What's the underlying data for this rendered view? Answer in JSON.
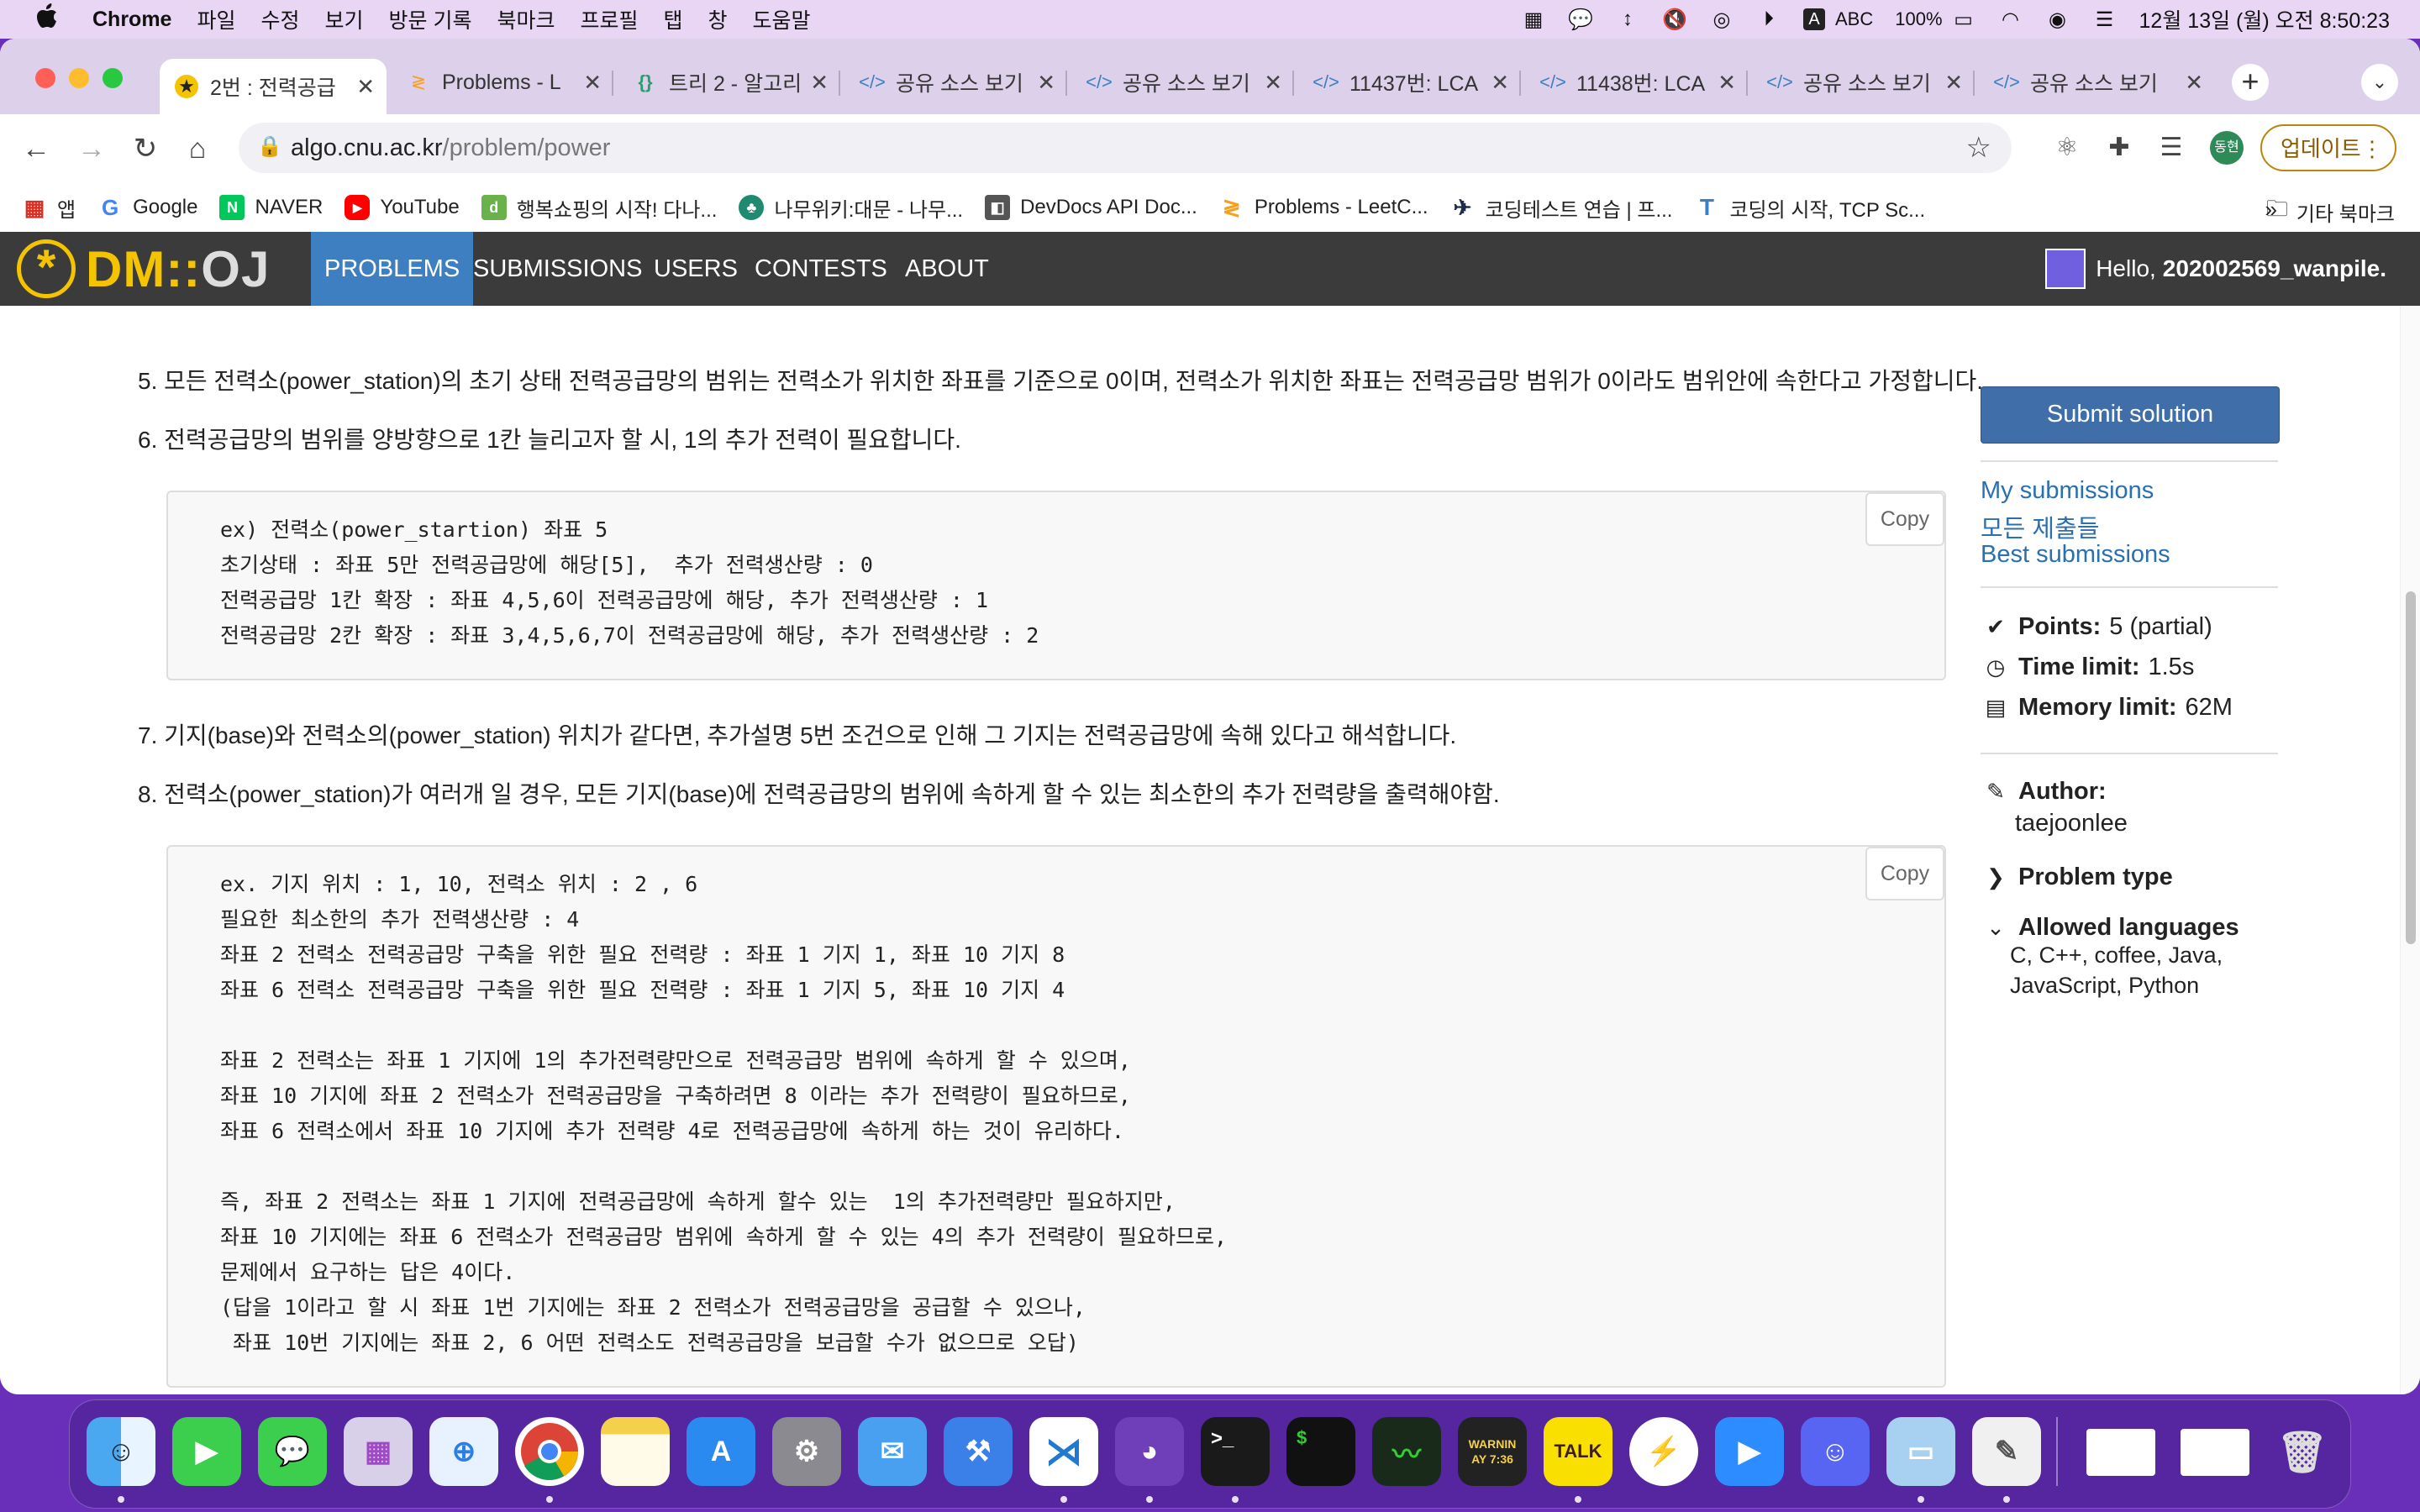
{
  "menubar": {
    "apple": "",
    "app": "Chrome",
    "items": [
      "파일",
      "수정",
      "보기",
      "방문 기록",
      "북마크",
      "프로필",
      "탭",
      "창",
      "도움말"
    ],
    "input_source": "ABC",
    "battery": "100%",
    "datetime": "12월 13일 (월) 오전 8:50:23"
  },
  "tabs": [
    {
      "title": "2번 : 전력공급",
      "icon": "dmoj-icon"
    },
    {
      "title": "Problems - L",
      "icon": "leetcode-icon"
    },
    {
      "title": "트리 2 - 알고리",
      "icon": "code-braces-icon"
    },
    {
      "title": "공유 소스 보기",
      "icon": "code-icon"
    },
    {
      "title": "공유 소스 보기",
      "icon": "code-icon"
    },
    {
      "title": "11437번: LCA",
      "icon": "code-icon"
    },
    {
      "title": "11438번: LCA",
      "icon": "code-icon"
    },
    {
      "title": "공유 소스 보기",
      "icon": "code-icon"
    },
    {
      "title": "공유 소스 보기",
      "icon": "code-icon"
    }
  ],
  "address": {
    "host": "algo.cnu.ac.kr",
    "path": "/problem/power"
  },
  "profile_badge": "동현",
  "update_label": "업데이트",
  "bookmarks": [
    {
      "label": "앱",
      "color": "#d93025",
      "glyph": "▦"
    },
    {
      "label": "Google",
      "color": "#4285f4",
      "glyph": "G"
    },
    {
      "label": "NAVER",
      "color": "#03c75a",
      "glyph": "N"
    },
    {
      "label": "YouTube",
      "color": "#ff0000",
      "glyph": "▶"
    },
    {
      "label": "행복쇼핑의 시작! 다나...",
      "color": "#6ab04c",
      "glyph": "d"
    },
    {
      "label": "나무위키:대문 - 나무...",
      "color": "#1f8a70",
      "glyph": "♣"
    },
    {
      "label": "DevDocs API Doc...",
      "color": "#555555",
      "glyph": "◧"
    },
    {
      "label": "Problems - LeetC...",
      "color": "#f89f1b",
      "glyph": "≷"
    },
    {
      "label": "코딩테스트 연습 | 프...",
      "color": "#1a2b4c",
      "glyph": "✈"
    },
    {
      "label": "코딩의 시작, TCP Sc...",
      "color": "#3d7fc1",
      "glyph": "T"
    }
  ],
  "bookmarks_more": "»",
  "bookmarks_other": "기타 북마크",
  "site": {
    "logo_main": "DM",
    "logo_sep": "::",
    "logo_oj": "OJ",
    "nav": [
      "PROBLEMS",
      "SUBMISSIONS",
      "USERS",
      "CONTESTS",
      "ABOUT"
    ],
    "hello": "Hello,",
    "username": "202002569_wanpile."
  },
  "problem": {
    "item5": "5. 모든 전력소(power_station)의 초기 상태 전력공급망의 범위는 전력소가 위치한 좌표를 기준으로 0이며, 전력소가 위치한 좌표는 전력공급망 범위가 0이라도 범위안에 속한다고 가정합니다.",
    "item6": "6. 전력공급망의 범위를 양방향으로 1칸 늘리고자 할 시, 1의 추가 전력이 필요합니다.",
    "code1": "ex) 전력소(power_startion) 좌표 5\n초기상태 : 좌표 5만 전력공급망에 해당[5],  추가 전력생산량 : 0\n전력공급망 1칸 확장 : 좌표 4,5,6이 전력공급망에 해당, 추가 전력생산량 : 1\n전력공급망 2칸 확장 : 좌표 3,4,5,6,7이 전력공급망에 해당, 추가 전력생산량 : 2",
    "item7": "7. 기지(base)와 전력소의(power_station) 위치가 같다면, 추가설명 5번 조건으로 인해 그 기지는 전력공급망에 속해 있다고 해석합니다.",
    "item8": "8. 전력소(power_station)가 여러개 일 경우, 모든 기지(base)에 전력공급망의 범위에 속하게 할 수 있는 최소한의 추가 전력량을 출력해야함.",
    "code2": "ex. 기지 위치 : 1, 10, 전력소 위치 : 2 , 6\n필요한 최소한의 추가 전력생산량 : 4\n좌표 2 전력소 전력공급망 구축을 위한 필요 전력량 : 좌표 1 기지 1, 좌표 10 기지 8\n좌표 6 전력소 전력공급망 구축을 위한 필요 전력량 : 좌표 1 기지 5, 좌표 10 기지 4\n\n좌표 2 전력소는 좌표 1 기지에 1의 추가전력량만으로 전력공급망 범위에 속하게 할 수 있으며,\n좌표 10 기지에 좌표 2 전력소가 전력공급망을 구축하려면 8 이라는 추가 전력량이 필요하므로,\n좌표 6 전력소에서 좌표 10 기지에 추가 전력량 4로 전력공급망에 속하게 하는 것이 유리하다.\n\n즉, 좌표 2 전력소는 좌표 1 기지에 전력공급망에 속하게 할수 있는  1의 추가전력량만 필요하지만,\n좌표 10 기지에는 좌표 6 전력소가 전력공급망 범위에 속하게 할 수 있는 4의 추가 전력량이 필요하므로,\n문제에서 요구하는 답은 4이다.\n(답을 1이라고 할 시 좌표 1번 기지에는 좌표 2 전력소가 전력공급망을 공급할 수 있으나,\n 좌표 10번 기지에는 좌표 2, 6 어떤 전력소도 전력공급망을 보급할 수가 없으므로 오답)",
    "copy_label": "Copy"
  },
  "sidebar": {
    "submit": "Submit solution",
    "my_submissions": "My submissions",
    "all_submissions": "모든 제출들",
    "best_submissions": "Best submissions",
    "points_label": "Points:",
    "points_value": "5 (partial)",
    "time_label": "Time limit:",
    "time_value": "1.5s",
    "memory_label": "Memory limit:",
    "memory_value": "62M",
    "author_label": "Author:",
    "author_value": "taejoonlee",
    "problem_type_label": "Problem type",
    "allowed_label": "Allowed languages",
    "allowed_line1": "C, C++, coffee, Java,",
    "allowed_line2": "JavaScript, Python"
  },
  "dock": {
    "terminal_text": ">_",
    "console_text": "WARNIN\nAY 7:36",
    "kakao_text": "TALK"
  }
}
